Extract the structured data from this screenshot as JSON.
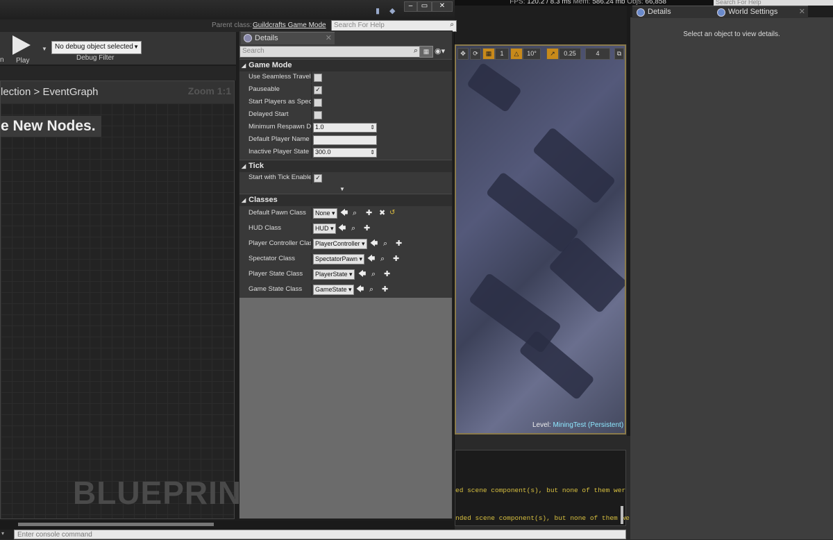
{
  "stats": {
    "fps_label": "FPS:",
    "fps_value": "120.2 / 8.3 ms",
    "mem_label": "Mem:",
    "mem_value": "586.24 mb",
    "objs_label": "Objs:",
    "objs_value": "66,858"
  },
  "blueprint": {
    "parent_class_label": "Parent class:",
    "parent_class_value": "Guildcrafts Game Mode",
    "help_search_placeholder": "Search For Help",
    "toolbar": {
      "play_label": "Play",
      "debug_object": "No debug object selected",
      "debug_filter_label": "Debug Filter"
    },
    "graph": {
      "breadcrumb_prefix": "lection",
      "breadcrumb_current": "EventGraph",
      "zoom": "Zoom 1:1",
      "hint": "e New Nodes.",
      "watermark": "BLUEPRINT"
    }
  },
  "details": {
    "tab_label": "Details",
    "search_placeholder": "Search",
    "categories": {
      "game_mode": "Game Mode",
      "tick": "Tick",
      "classes": "Classes"
    },
    "game_mode_rows": {
      "seamless": "Use Seamless Travel",
      "pauseable": "Pauseable",
      "spectators": "Start Players as Spect",
      "delayed": "Delayed Start",
      "respawn": "Minimum Respawn Del",
      "respawn_value": "1.0",
      "player_name": "Default Player Name",
      "inactive": "Inactive Player State L",
      "inactive_value": "300.0"
    },
    "tick_rows": {
      "start_tick": "Start with Tick Enablec"
    },
    "class_rows": {
      "pawn": "Default Pawn Class",
      "pawn_value": "None",
      "hud": "HUD Class",
      "hud_value": "HUD",
      "controller": "Player Controller Class",
      "controller_value": "PlayerController",
      "spectator": "Spectator Class",
      "spectator_value": "SpectatorPawn",
      "state": "Player State Class",
      "state_value": "PlayerState",
      "game_state": "Game State Class",
      "game_state_value": "GameState"
    }
  },
  "viewport": {
    "toolbar": {
      "layers": "1",
      "angle": "10°",
      "scale": "0.25",
      "cam": "4"
    },
    "level_label": "Level:",
    "level_value": "MiningTest (Persistent)"
  },
  "log": {
    "line1": "ed scene component(s), but none of them wer",
    "line2": "nded scene component(s), but none of them we"
  },
  "right_panel": {
    "help_placeholder": "Search For Help",
    "tab_details": "Details",
    "tab_world": "World Settings",
    "empty_message": "Select an object to view details."
  },
  "console": {
    "placeholder": "Enter console command"
  },
  "colors": {
    "accent_orange": "#c88a1a",
    "level_cyan": "#8ee8ff",
    "log_yellow": "#d8c040"
  }
}
